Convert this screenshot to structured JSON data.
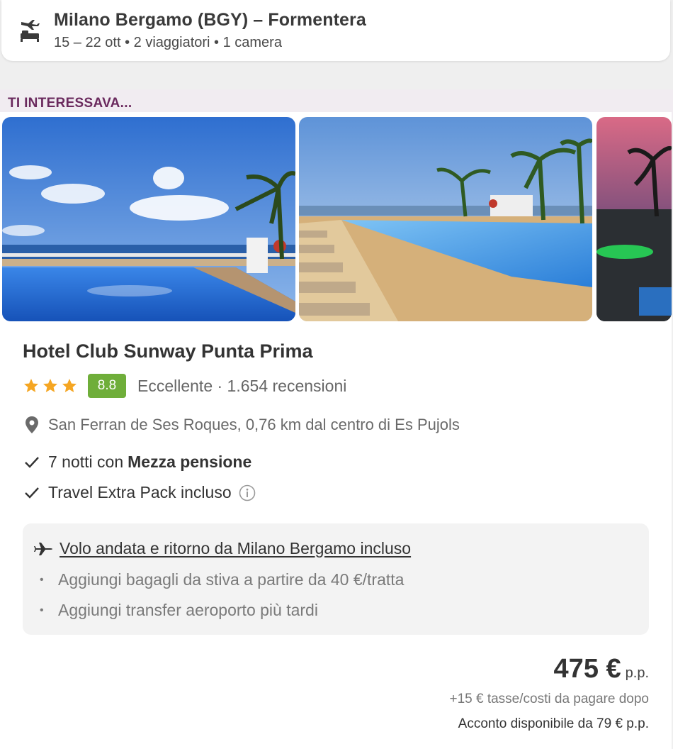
{
  "trip": {
    "title": "Milano Bergamo (BGY) – Formentera",
    "subtitle": "15 – 22 ott • 2 viaggiatori • 1 camera",
    "icon": "flight-hotel-icon"
  },
  "section": {
    "label": "TI INTERESSAVA..."
  },
  "hotel": {
    "name": "Hotel Club Sunway Punta Prima",
    "stars": 3,
    "score": "8.8",
    "rating_text": "Eccellente · 1.654 recensioni",
    "location": "San Ferran de Ses Roques, 0,76 km dal centro di Es Pujols",
    "feature_1_prefix": "7 notti con",
    "feature_1_bold": "Mezza pensione",
    "feature_2": "Travel Extra Pack incluso",
    "photos": [
      "pool-sea-view-photo",
      "pool-loungers-photo",
      "pool-night-photo"
    ]
  },
  "flight": {
    "link": "Volo andata e ritorno da Milano Bergamo incluso",
    "bullets": [
      "Aggiungi bagagli da stiva a partire da 40 €/tratta",
      "Aggiungi transfer aeroporto più tardi"
    ]
  },
  "price": {
    "amount": "475 €",
    "unit": "p.p.",
    "taxes": "+15 € tasse/costi da pagare dopo",
    "deposit": "Acconto disponibile da 79 € p.p."
  },
  "colors": {
    "score_bg": "#6fae3a",
    "star": "#f5a623",
    "section_label": "#6b2a5e"
  }
}
